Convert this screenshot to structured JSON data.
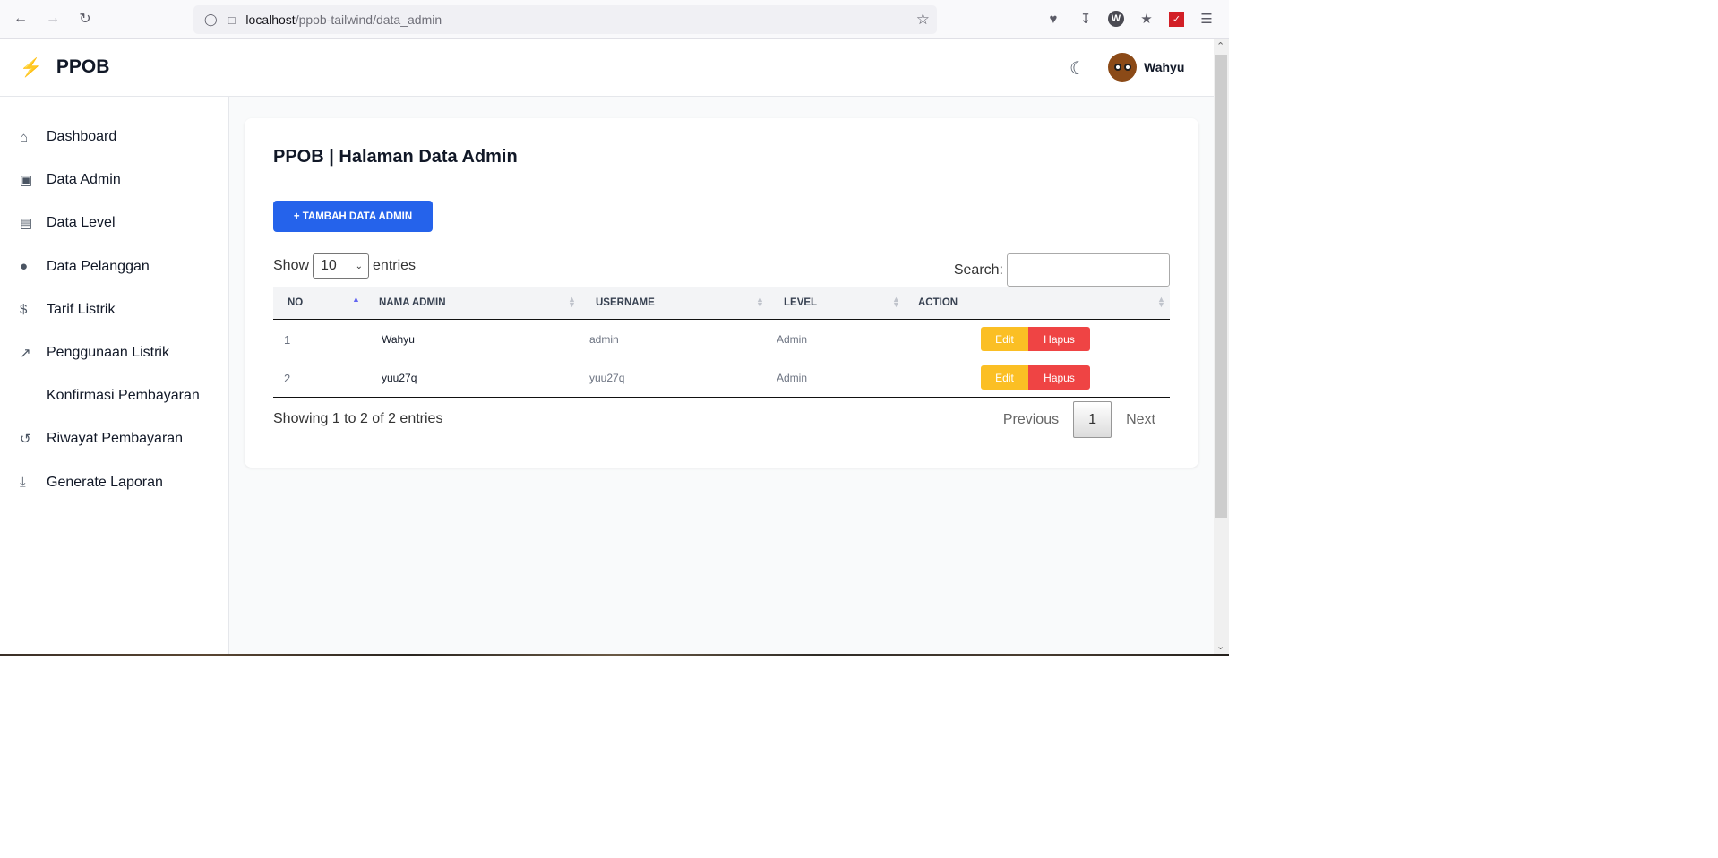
{
  "browser": {
    "url_host": "localhost",
    "url_path": "/ppob-tailwind/data_admin"
  },
  "app": {
    "brand": "PPOB",
    "user_name": "Wahyu"
  },
  "sidebar": {
    "items": [
      {
        "label": "Dashboard",
        "icon": "home-icon"
      },
      {
        "label": "Data Admin",
        "icon": "contact-book-icon"
      },
      {
        "label": "Data Level",
        "icon": "id-card-icon"
      },
      {
        "label": "Data Pelanggan",
        "icon": "user-icon"
      },
      {
        "label": "Tarif Listrik",
        "icon": "dollar-icon"
      },
      {
        "label": "Penggunaan Listrik",
        "icon": "chart-line-icon"
      },
      {
        "label": "Konfirmasi Pembayaran",
        "icon": ""
      },
      {
        "label": "Riwayat Pembayaran",
        "icon": "history-icon"
      },
      {
        "label": "Generate Laporan",
        "icon": "download-icon"
      }
    ]
  },
  "main": {
    "title": "PPOB | Halaman Data Admin",
    "add_button": "+ TAMBAH DATA ADMIN",
    "show_label": "Show",
    "entries_label": "entries",
    "page_length": "10",
    "search_label": "Search:",
    "columns": [
      "NO",
      "NAMA ADMIN",
      "USERNAME",
      "LEVEL",
      "ACTION"
    ],
    "rows": [
      {
        "no": "1",
        "nama": "Wahyu",
        "username": "admin",
        "level": "Admin"
      },
      {
        "no": "2",
        "nama": "yuu27q",
        "username": "yuu27q",
        "level": "Admin"
      }
    ],
    "edit_label": "Edit",
    "delete_label": "Hapus",
    "info": "Showing 1 to 2 of 2 entries",
    "prev_label": "Previous",
    "current_page": "1",
    "next_label": "Next"
  },
  "colors": {
    "primary": "#2563eb",
    "edit": "#fbbf24",
    "delete": "#ef4444"
  }
}
